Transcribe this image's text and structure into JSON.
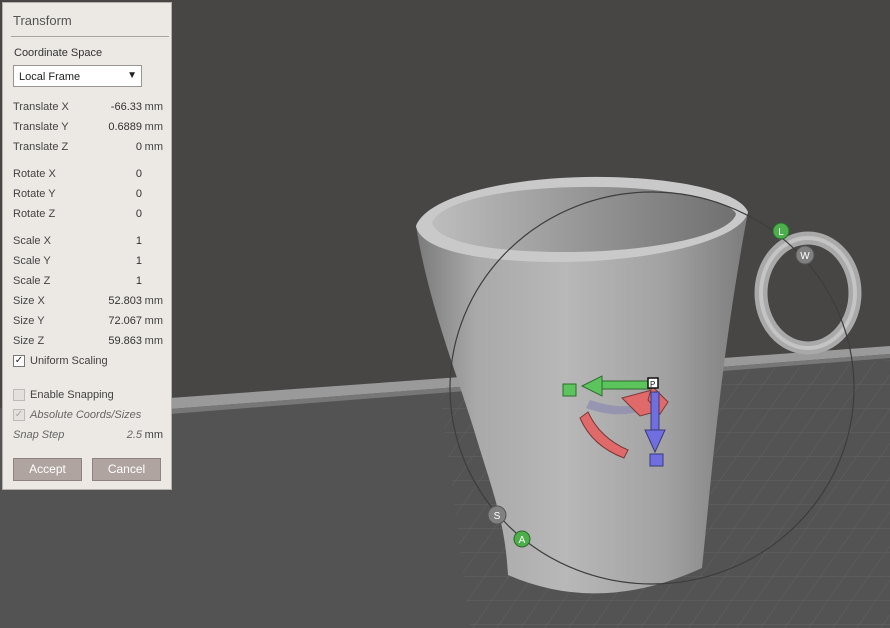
{
  "panel": {
    "title": "Transform",
    "coordinate_space_label": "Coordinate Space",
    "coordinate_space_value": "Local Frame",
    "fields": [
      {
        "label": "Translate X",
        "value": "-66.33",
        "unit": "mm"
      },
      {
        "label": "Translate Y",
        "value": "0.6889",
        "unit": "mm"
      },
      {
        "label": "Translate Z",
        "value": "0",
        "unit": "mm"
      },
      {
        "label": "Rotate X",
        "value": "0",
        "unit": ""
      },
      {
        "label": "Rotate Y",
        "value": "0",
        "unit": ""
      },
      {
        "label": "Rotate Z",
        "value": "0",
        "unit": ""
      },
      {
        "label": "Scale X",
        "value": "1",
        "unit": ""
      },
      {
        "label": "Scale Y",
        "value": "1",
        "unit": ""
      },
      {
        "label": "Scale Z",
        "value": "1",
        "unit": ""
      },
      {
        "label": "Size X",
        "value": "52.803",
        "unit": "mm"
      },
      {
        "label": "Size Y",
        "value": "72.067",
        "unit": "mm"
      },
      {
        "label": "Size Z",
        "value": "59.863",
        "unit": "mm"
      }
    ],
    "uniform_scaling": {
      "label": "Uniform Scaling",
      "checked": true
    },
    "enable_snapping": {
      "label": "Enable Snapping",
      "checked": false
    },
    "absolute_coords": {
      "label": "Absolute Coords/Sizes",
      "checked": true
    },
    "snap_step": {
      "label": "Snap Step",
      "value": "2.5",
      "unit": "mm"
    },
    "accept_label": "Accept",
    "cancel_label": "Cancel"
  },
  "gizmo": {
    "handle_l": "L",
    "handle_w": "W",
    "handle_s": "S",
    "handle_a": "A",
    "pivot": "P"
  },
  "colors": {
    "x_axis": "#e06a6a",
    "y_axis": "#5cc45c",
    "z_axis": "#6f6fe0",
    "viewport_bg": "#474645",
    "grid_floor": "#5a5959",
    "panel_bg": "#ece8e4",
    "button_bg": "#b0a4a0"
  }
}
